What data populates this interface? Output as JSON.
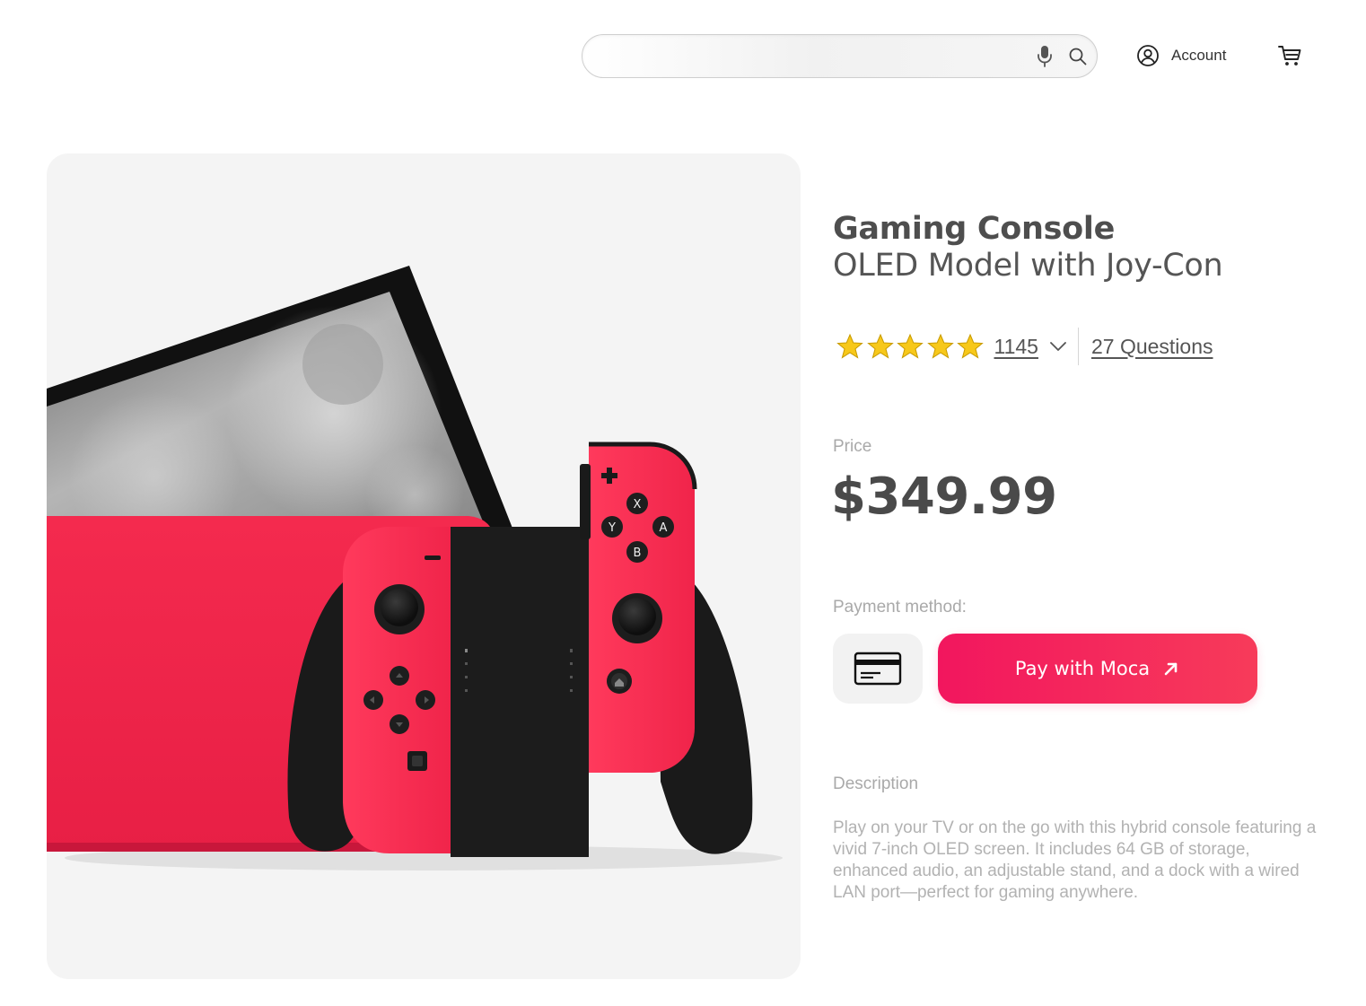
{
  "header": {
    "search": {
      "placeholder": "",
      "value": ""
    },
    "icons": {
      "mic": "mic-icon",
      "search": "search-icon",
      "account": "user-circle-icon",
      "cart": "cart-icon"
    },
    "account_label": "Account"
  },
  "product": {
    "image_alt": "gaming-console-image",
    "title_line1": "Gaming Console",
    "title_line2": "OLED Model with Joy-Con",
    "rating": {
      "stars": 5,
      "max": 5,
      "review_count": "1145",
      "questions_label": "27 Questions"
    },
    "price_label": "Price",
    "price": "$349.99",
    "payment_label": "Payment method:",
    "pay_button_label": "Pay with Moca",
    "description_label": "Description",
    "description": "Play on your TV or on the go with this hybrid console featuring a vivid 7-inch OLED screen. It includes 64 GB of storage, enhanced audio, an adjustable stand, and a dock with a wired LAN port—perfect for gaming anywhere.",
    "controller_button_letters": [
      "X",
      "Y",
      "A",
      "B"
    ]
  },
  "colors": {
    "accent": "#f2165e",
    "accent_end": "#f73b5a",
    "console_red": "#f42a4e",
    "star": "#f7c81a",
    "text_dark": "#4a4a4a",
    "text_muted": "#a9a9a9"
  }
}
